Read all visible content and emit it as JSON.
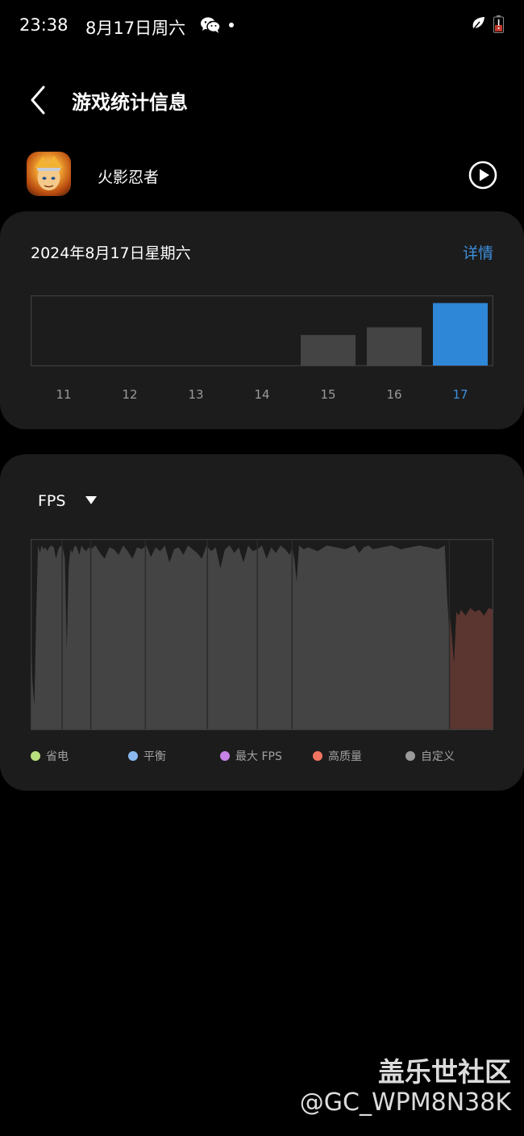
{
  "status_bar": {
    "time": "23:38",
    "date": "8月17日周六",
    "icons": [
      "wechat-icon",
      "dot-icon",
      "leaf-icon",
      "battery-icon"
    ]
  },
  "header": {
    "title": "游戏统计信息",
    "back_icon": "chevron-left-icon"
  },
  "game": {
    "name": "火影忍者",
    "play_icon": "play-circle-icon"
  },
  "daily_card": {
    "date": "2024年8月17日星期六",
    "details_label": "详情",
    "chart_data": {
      "type": "bar",
      "categories": [
        "11",
        "12",
        "13",
        "14",
        "15",
        "16",
        "17"
      ],
      "values": [
        0,
        0,
        0,
        0,
        0.44,
        0.55,
        0.9
      ],
      "selected_category": "17",
      "ylim": [
        0,
        1
      ],
      "colors": {
        "bar": "#444444",
        "selected": "#2f87d7",
        "selected_label": "#3d8fdd",
        "label": "#9a9a9a"
      }
    }
  },
  "fps_card": {
    "metric_label": "FPS",
    "dropdown_icon": "triangle-down-icon",
    "chart_data": {
      "type": "area",
      "ylim": [
        0,
        1
      ],
      "xlim": [
        0,
        1
      ],
      "segment_dividers": [
        0.068,
        0.13,
        0.248,
        0.382,
        0.49,
        0.565,
        0.905
      ],
      "series": [
        {
          "mode": "custom",
          "color": "#444444",
          "x": [
            0.0,
            0.004,
            0.008,
            0.012,
            0.016,
            0.02,
            0.024,
            0.028,
            0.032,
            0.036,
            0.04,
            0.045,
            0.05,
            0.055,
            0.06,
            0.065,
            0.07,
            0.074,
            0.078,
            0.082,
            0.086,
            0.09,
            0.095,
            0.1,
            0.105,
            0.11,
            0.115,
            0.12,
            0.125,
            0.13,
            0.14,
            0.15,
            0.16,
            0.17,
            0.18,
            0.19,
            0.2,
            0.21,
            0.22,
            0.23,
            0.24,
            0.25,
            0.26,
            0.27,
            0.28,
            0.29,
            0.3,
            0.31,
            0.32,
            0.33,
            0.34,
            0.35,
            0.36,
            0.37,
            0.38,
            0.39,
            0.4,
            0.41,
            0.42,
            0.43,
            0.44,
            0.45,
            0.46,
            0.47,
            0.48,
            0.49,
            0.5,
            0.51,
            0.52,
            0.53,
            0.54,
            0.55,
            0.56,
            0.565,
            0.57,
            0.575,
            0.58,
            0.59,
            0.6,
            0.62,
            0.64,
            0.66,
            0.68,
            0.7,
            0.71,
            0.72,
            0.73,
            0.74,
            0.76,
            0.78,
            0.8,
            0.82,
            0.84,
            0.86,
            0.88,
            0.895,
            0.9,
            0.905
          ],
          "y": [
            0.55,
            0.25,
            0.12,
            0.6,
            0.97,
            0.93,
            0.97,
            0.95,
            0.96,
            0.94,
            0.96,
            0.97,
            0.96,
            0.9,
            0.95,
            0.97,
            0.95,
            0.9,
            0.42,
            0.85,
            0.95,
            0.93,
            0.97,
            0.96,
            0.92,
            0.97,
            0.95,
            0.94,
            0.96,
            0.95,
            0.97,
            0.93,
            0.9,
            0.96,
            0.95,
            0.92,
            0.97,
            0.94,
            0.9,
            0.96,
            0.95,
            0.97,
            0.91,
            0.96,
            0.94,
            0.97,
            0.88,
            0.95,
            0.96,
            0.92,
            0.97,
            0.95,
            0.93,
            0.9,
            0.97,
            0.94,
            0.96,
            0.85,
            0.95,
            0.97,
            0.93,
            0.96,
            0.88,
            0.97,
            0.94,
            0.95,
            0.97,
            0.9,
            0.96,
            0.93,
            0.97,
            0.95,
            0.92,
            0.96,
            0.9,
            0.78,
            0.97,
            0.95,
            0.96,
            0.94,
            0.97,
            0.96,
            0.95,
            0.97,
            0.93,
            0.96,
            0.97,
            0.95,
            0.96,
            0.97,
            0.95,
            0.96,
            0.97,
            0.96,
            0.95,
            0.97,
            0.7,
            0.5
          ]
        },
        {
          "mode": "high-quality",
          "color": "#5b3530",
          "x": [
            0.905,
            0.91,
            0.915,
            0.92,
            0.925,
            0.93,
            0.94,
            0.95,
            0.96,
            0.97,
            0.98,
            0.99,
            1.0
          ],
          "y": [
            0.62,
            0.5,
            0.35,
            0.62,
            0.6,
            0.63,
            0.6,
            0.64,
            0.62,
            0.63,
            0.6,
            0.64,
            0.63
          ]
        }
      ]
    },
    "legend": [
      {
        "label": "省电",
        "color": "#b8e07c"
      },
      {
        "label": "平衡",
        "color": "#8ab8f0"
      },
      {
        "label": "最大 FPS",
        "color": "#c882e8"
      },
      {
        "label": "高质量",
        "color": "#f07460"
      },
      {
        "label": "自定义",
        "color": "#9a9a9a"
      }
    ]
  },
  "watermark": {
    "line1": "盖乐世社区",
    "line2": "@GC_WPM8N38K"
  }
}
